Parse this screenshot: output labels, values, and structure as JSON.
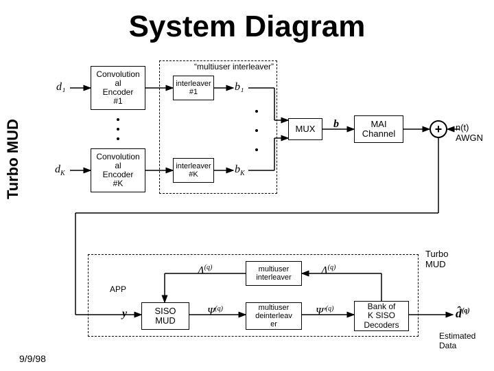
{
  "title": "System Diagram",
  "ylabel": "Turbo MUD",
  "date": "9/9/98",
  "inputs": {
    "d1": "d₁",
    "dK": "d_K"
  },
  "blocks": {
    "enc1": "Convolution\nal\nEncoder\n#1",
    "encK": "Convolution\nal\nEncoder\n#K",
    "int1": "interleaver\n#1",
    "intK": "interleaver\n#K",
    "mux": "MUX",
    "mai": "MAI\nChannel",
    "app": "APP",
    "siso": "SISO\nMUD",
    "mi": "multiuser\ninterleaver",
    "mdi": "multiuser\ndeinterleav\ner",
    "bank": "Bank of\nK SISO\nDecoders"
  },
  "labels": {
    "multiuser_int_group": "“multiuser interleaver”",
    "b1": "b₁",
    "bK": "b_K",
    "bvec": "b",
    "plus": "+",
    "noise": "n(t)\nAWGN",
    "turbo_mud": "Turbo\nMUD",
    "y": "y",
    "Lambda_q_s": "Λ",
    "Lambda_q_l": "Λ",
    "Psi_q_s": "Ψ",
    "Psi_q_l": "Ψ",
    "dhat": "d̂",
    "est": "Estimated\nData",
    "sup_q": "(q)"
  }
}
